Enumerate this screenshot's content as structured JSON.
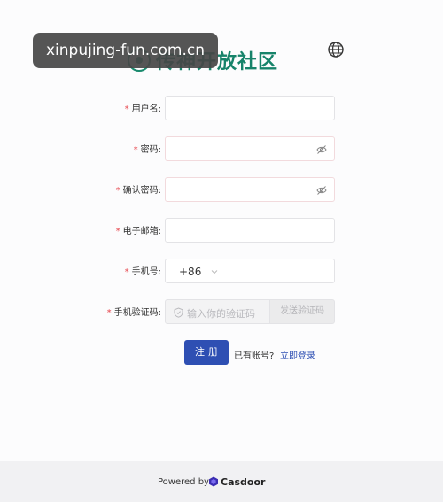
{
  "watermark": "xinpujing-fun.com.cn",
  "header": {
    "title": "传神开放社区",
    "logo_icon": "community-logo-icon",
    "language_icon": "globe-icon"
  },
  "form": {
    "required_mark": "*",
    "username": {
      "label": "用户名:",
      "value": ""
    },
    "password": {
      "label": "密码:",
      "value": "",
      "toggle_icon": "eye-off-icon"
    },
    "confirm": {
      "label": "确认密码:",
      "value": "",
      "toggle_icon": "eye-off-icon"
    },
    "email": {
      "label": "电子邮箱:",
      "value": ""
    },
    "phone": {
      "label": "手机号:",
      "country_code": "+86",
      "value": ""
    },
    "code": {
      "label": "手机验证码:",
      "placeholder": "输入你的验证码",
      "send_label": "发送验证码"
    }
  },
  "actions": {
    "register_label": "注册",
    "have_account": "已有账号?",
    "login_link": "立即登录"
  },
  "footer": {
    "powered_by": "Powered by",
    "brand": "Casdoor"
  },
  "colors": {
    "brand_green": "#17836a",
    "primary_blue": "#2e4fb3",
    "required_red": "#e6424a"
  }
}
